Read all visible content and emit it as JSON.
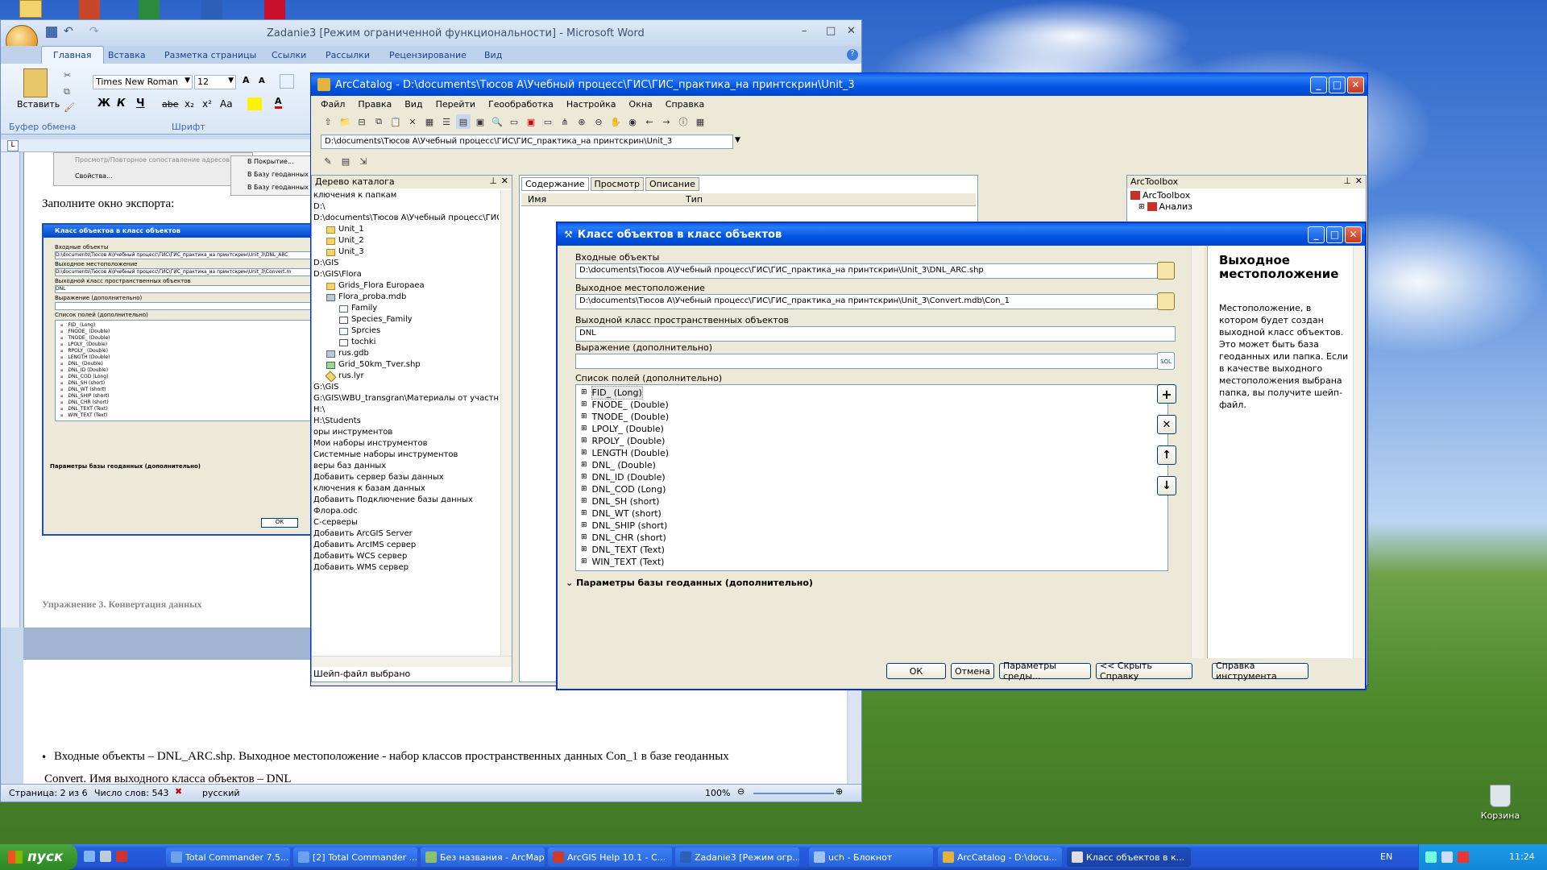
{
  "word": {
    "title": "Zadanie3 [Режим ограниченной функциональности] - Microsoft Word",
    "tabs": [
      "Главная",
      "Вставка",
      "Разметка страницы",
      "Ссылки",
      "Рассылки",
      "Рецензирование",
      "Вид"
    ],
    "paste_label": "Вставить",
    "clipboard_label": "Буфер обмена",
    "font_group": "Шрифт",
    "font_name": "Times New Roman",
    "font_size": "12",
    "fmt_bold": "Ж",
    "fmt_italic": "К",
    "fmt_underline": "Ч",
    "fmt_strike": "abe",
    "fmt_sub": "x₂",
    "fmt_sup": "x²",
    "fmt_case": "Aa",
    "doc_menu": [
      "Просмотр/Повторное сопоставление адресов",
      "Свойства..."
    ],
    "doc_submenu": [
      "В Покрытие...",
      "В Базу геоданных (ед",
      "В Базу геоданных (не"
    ],
    "doc_heading": "Заполните окно экспорта:",
    "mini": {
      "title": "Класс объектов в класс объектов",
      "l1": "Входные объекты",
      "v1": "D:\\documents\\Тюсов А\\Учебный процесс\\ГИС\\ГИС_практика_на принтскрин\\Unit_3\\DNL_ARC",
      "l2": "Выходное местоположение",
      "v2": "D:\\documents\\Тюсов А\\Учебный процесс\\ГИС\\ГИС_практика_на принтскрин\\Unit_3\\Convert.m",
      "l3": "Выходной класс пространственных объектов",
      "v3": "DNL",
      "l4": "Выражение (дополнительно)",
      "l5": "Список полей (дополнительно)",
      "params": "Параметры базы геоданных (дополнительно)",
      "ok": "ОК"
    },
    "exercise": "Упражнение 3. Конвертация данных",
    "bullet_line1": "Входные объекты – DNL_ARC.shp. Выходное местоположение - набор классов пространственных данных Con_1 в базе геоданных",
    "bullet_line2": "Convert. Имя выходного класса объектов – DNL",
    "status_page": "Страница: 2 из 6",
    "status_words": "Число слов: 543",
    "status_lang": "русский",
    "zoom": "100%"
  },
  "arccatalog": {
    "title": "ArcCatalog - D:\\documents\\Тюсов А\\Учебный процесс\\ГИС\\ГИС_практика_на принтскрин\\Unit_3",
    "menu": [
      "Файл",
      "Правка",
      "Вид",
      "Перейти",
      "Геообработка",
      "Настройка",
      "Окна",
      "Справка"
    ],
    "address": "D:\\documents\\Тюсов А\\Учебный процесс\\ГИС\\ГИС_практика_на принтскрин\\Unit_3",
    "tree_title": "Дерево каталога",
    "tree": [
      {
        "t": "ключения к  папкам",
        "i": 0,
        "ic": ""
      },
      {
        "t": "D:\\",
        "i": 0,
        "ic": ""
      },
      {
        "t": "D:\\documents\\Тюсов А\\Учебный процесс\\ГИС\\ГИС_пра",
        "i": 0,
        "ic": ""
      },
      {
        "t": "Unit_1",
        "i": 1,
        "ic": "folder"
      },
      {
        "t": "Unit_2",
        "i": 1,
        "ic": "folder"
      },
      {
        "t": "Unit_3",
        "i": 1,
        "ic": "folder"
      },
      {
        "t": "D:\\GIS",
        "i": 0,
        "ic": ""
      },
      {
        "t": "D:\\GIS\\Flora",
        "i": 0,
        "ic": ""
      },
      {
        "t": "Grids_Flora Europaea",
        "i": 1,
        "ic": "folder"
      },
      {
        "t": "Flora_proba.mdb",
        "i": 1,
        "ic": "db"
      },
      {
        "t": "Family",
        "i": 2,
        "ic": "table"
      },
      {
        "t": "Species_Family",
        "i": 2,
        "ic": "rel"
      },
      {
        "t": "Sprcies",
        "i": 2,
        "ic": "table"
      },
      {
        "t": "tochki",
        "i": 2,
        "ic": "pt"
      },
      {
        "t": "rus.gdb",
        "i": 1,
        "ic": "db"
      },
      {
        "t": "Grid_50km_Tver.shp",
        "i": 1,
        "ic": "grid"
      },
      {
        "t": "rus.lyr",
        "i": 1,
        "ic": "lyr"
      },
      {
        "t": "G:\\GIS",
        "i": 0,
        "ic": ""
      },
      {
        "t": "G:\\GIS\\WBU_transgran\\Материалы от участников",
        "i": 0,
        "ic": ""
      },
      {
        "t": "H:\\",
        "i": 0,
        "ic": ""
      },
      {
        "t": "H:\\Students",
        "i": 0,
        "ic": ""
      },
      {
        "t": "оры инструментов",
        "i": 0,
        "ic": ""
      },
      {
        "t": "Мои наборы инструментов",
        "i": 0,
        "ic": ""
      },
      {
        "t": "Системные наборы инструментов",
        "i": 0,
        "ic": ""
      },
      {
        "t": "веры баз данных",
        "i": 0,
        "ic": ""
      },
      {
        "t": "Добавить сервер базы данных",
        "i": 0,
        "ic": ""
      },
      {
        "t": "ключения к базам данных",
        "i": 0,
        "ic": ""
      },
      {
        "t": "Добавить Подключение базы данных",
        "i": 0,
        "ic": ""
      },
      {
        "t": "Флора.odc",
        "i": 0,
        "ic": ""
      },
      {
        "t": "С-серверы",
        "i": 0,
        "ic": ""
      },
      {
        "t": "Добавить ArcGIS Server",
        "i": 0,
        "ic": ""
      },
      {
        "t": "Добавить ArcIMS сервер",
        "i": 0,
        "ic": ""
      },
      {
        "t": "Добавить WCS сервер",
        "i": 0,
        "ic": ""
      },
      {
        "t": "Добавить WMS сервер",
        "i": 0,
        "ic": ""
      }
    ],
    "status": "Шейп-файл выбрано",
    "tabs": [
      "Содержание",
      "Просмотр",
      "Описание"
    ],
    "col_name": "Имя",
    "col_type": "Тип",
    "toolbox_title": "ArcToolbox",
    "toolbox_root": "ArcToolbox",
    "toolbox_child": "Анализ"
  },
  "dialog": {
    "title": "Класс объектов в класс объектов",
    "l_input": "Входные объекты",
    "v_input": "D:\\documents\\Тюсов А\\Учебный процесс\\ГИС\\ГИС_практика_на принтскрин\\Unit_3\\DNL_ARC.shp",
    "l_out": "Выходное местоположение",
    "v_out": "D:\\documents\\Тюсов А\\Учебный процесс\\ГИС\\ГИС_практика_на принтскрин\\Unit_3\\Convert.mdb\\Con_1",
    "l_class": "Выходной класс пространственных объектов",
    "v_class": "DNL",
    "l_expr": "Выражение (дополнительно)",
    "l_fields": "Список полей (дополнительно)",
    "fields": [
      "FID_ (Long)",
      "FNODE_ (Double)",
      "TNODE_ (Double)",
      "LPOLY_ (Double)",
      "RPOLY_ (Double)",
      "LENGTH (Double)",
      "DNL_ (Double)",
      "DNL_ID (Double)",
      "DNL_COD (Long)",
      "DNL_SH (short)",
      "DNL_WT (short)",
      "DNL_SHIP (short)",
      "DNL_CHR (short)",
      "DNL_TEXT (Text)",
      "WIN_TEXT (Text)"
    ],
    "params": "Параметры базы геоданных (дополнительно)",
    "help_title": "Выходное местоположение",
    "help_text": "Местоположение, в котором будет создан выходной класс объектов. Это может быть база геоданных или папка. Если в качестве выходного местоположения выбрана папка, вы получите шейп-файл.",
    "btn_ok": "ОК",
    "btn_cancel": "Отмена",
    "btn_env": "Параметры среды...",
    "btn_hide": "<< Скрыть Справку",
    "btn_help": "Справка инструмента"
  },
  "desktop": {
    "recycle": "Корзина"
  },
  "taskbar": {
    "start": "пуск",
    "items": [
      "Total Commander 7.5...",
      "[2] Total Commander ...",
      "Без названия - ArcMap",
      "ArcGIS Help 10.1 - C...",
      "Zadanie3 [Режим огр...",
      "uch - Блокнот",
      "ArcCatalog - D:\\docu...",
      "Класс объектов в к..."
    ],
    "lang": "EN",
    "time": "11:24"
  }
}
